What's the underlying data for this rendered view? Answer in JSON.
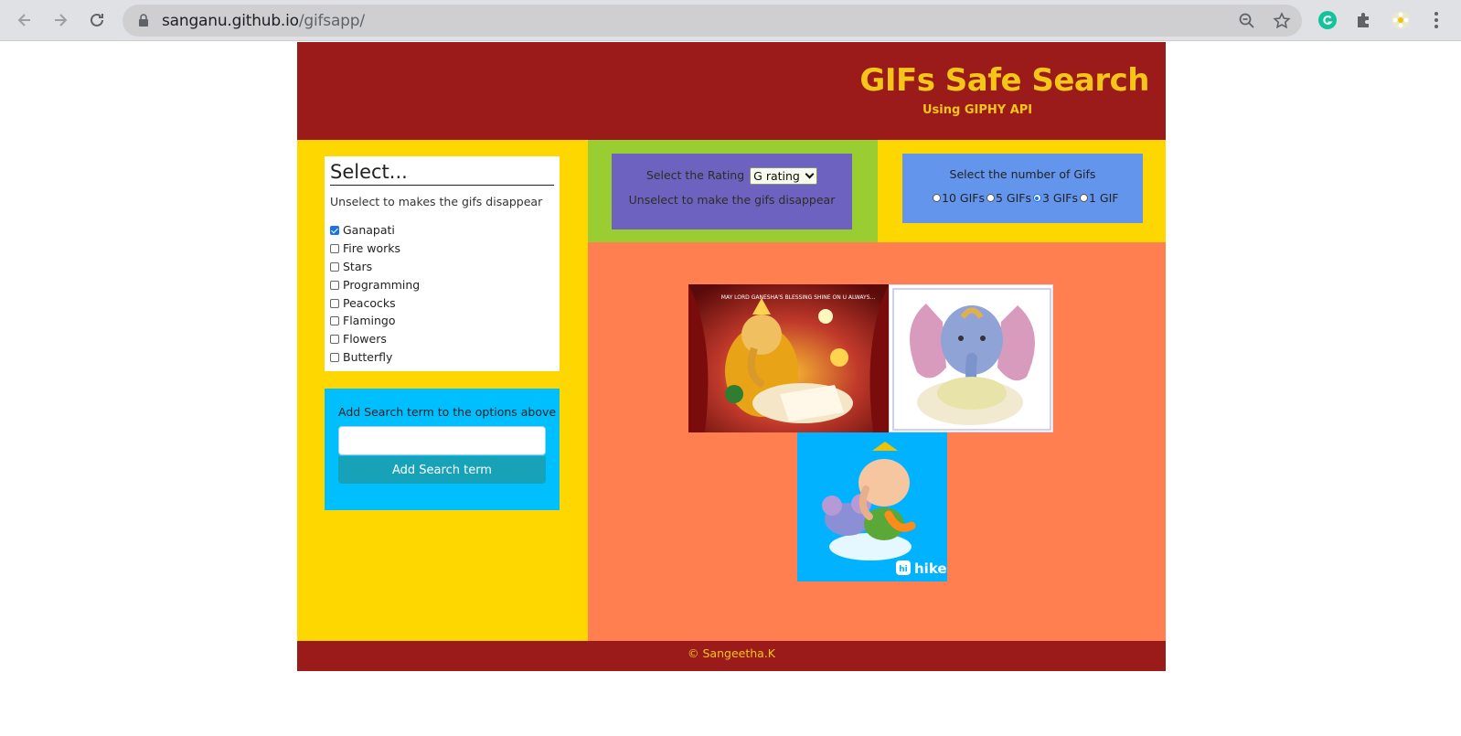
{
  "browser": {
    "url_host": "sanganu.github.io",
    "url_path": "/gifsapp/"
  },
  "header": {
    "title": "GIFs Safe Search",
    "subtitle": "Using GIPHY API"
  },
  "select_panel": {
    "title": "Select...",
    "hint": "Unselect to makes the gifs disappear",
    "options": [
      {
        "label": "Ganapati",
        "checked": true
      },
      {
        "label": "Fire works",
        "checked": false
      },
      {
        "label": "Stars",
        "checked": false
      },
      {
        "label": "Programming",
        "checked": false
      },
      {
        "label": "Peacocks",
        "checked": false
      },
      {
        "label": "Flamingo",
        "checked": false
      },
      {
        "label": "Flowers",
        "checked": false
      },
      {
        "label": "Butterfly",
        "checked": false
      }
    ]
  },
  "add_panel": {
    "label": "Add Search term to the options above",
    "input_value": "",
    "button_label": "Add Search term"
  },
  "rating_panel": {
    "label": "Select the Rating",
    "selected": "G rating",
    "hint": "Unselect to make the gifs disappear"
  },
  "count_panel": {
    "title": "Select the number of Gifs",
    "options": [
      {
        "label": "10 GIFs",
        "checked": false
      },
      {
        "label": "5 GIFs",
        "checked": false
      },
      {
        "label": "3 GIFs",
        "checked": true
      },
      {
        "label": "1 GIF",
        "checked": false
      }
    ]
  },
  "gifs": {
    "gif1_caption": "MAY LORD GANESHA'S BLESSING SHINE ON U ALWAYS...",
    "gif3_brand": "hike"
  },
  "footer": {
    "text": "© Sangeetha.K"
  },
  "colors": {
    "header_bg": "#9b1b1b",
    "title_color": "#f5c518",
    "left_bg": "#ffd700",
    "gif_area_bg": "#ff7f50",
    "rating_bg": "#6a5acd",
    "count_bg": "#6495ed",
    "add_bg": "#00bfff"
  }
}
